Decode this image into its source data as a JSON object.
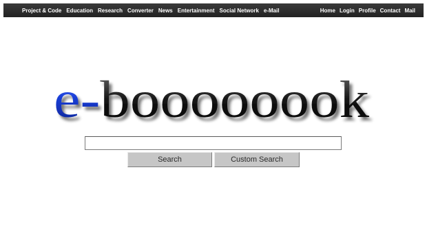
{
  "nav": {
    "left_items": [
      "Project & Code",
      "Education",
      "Research",
      "Converter",
      "News",
      "Entertainment",
      "Social Network",
      "e-Mail"
    ],
    "right_items": [
      "Home",
      "Login",
      "Profile",
      "Contact",
      "Mail"
    ]
  },
  "logo": {
    "text": "e-boooooook",
    "prefix": "e-",
    "suffix": "boooooook",
    "prefix_color": "#1a3fd8",
    "suffix_color": "#111111"
  },
  "search": {
    "value": "",
    "placeholder": ""
  },
  "buttons": {
    "search_label": "Search",
    "custom_search_label": "Custom Search"
  },
  "colors": {
    "topbar": "#2e2e2e",
    "button": "#c6c6c6"
  }
}
